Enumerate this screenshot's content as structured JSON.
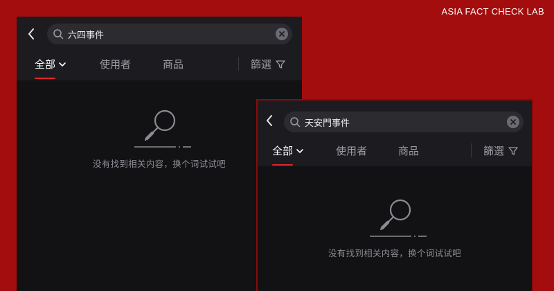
{
  "brand": "ASIA FACT CHECK LAB",
  "panels": [
    {
      "search_query": "六四事件",
      "tabs": {
        "all": "全部",
        "users": "使用者",
        "products": "商品"
      },
      "filter_label": "篩選",
      "empty_message": "没有找到相关内容，换个词试试吧"
    },
    {
      "search_query": "天安門事件",
      "tabs": {
        "all": "全部",
        "users": "使用者",
        "products": "商品"
      },
      "filter_label": "篩選",
      "empty_message": "没有找到相关内容，换个词试试吧"
    }
  ],
  "colors": {
    "background": "#a30d0d",
    "panel": "#121215",
    "accent": "#e0252b"
  },
  "icons": [
    "back-arrow-icon",
    "search-icon",
    "clear-icon",
    "chevron-down-icon",
    "filter-icon",
    "magnifier-empty-icon"
  ]
}
